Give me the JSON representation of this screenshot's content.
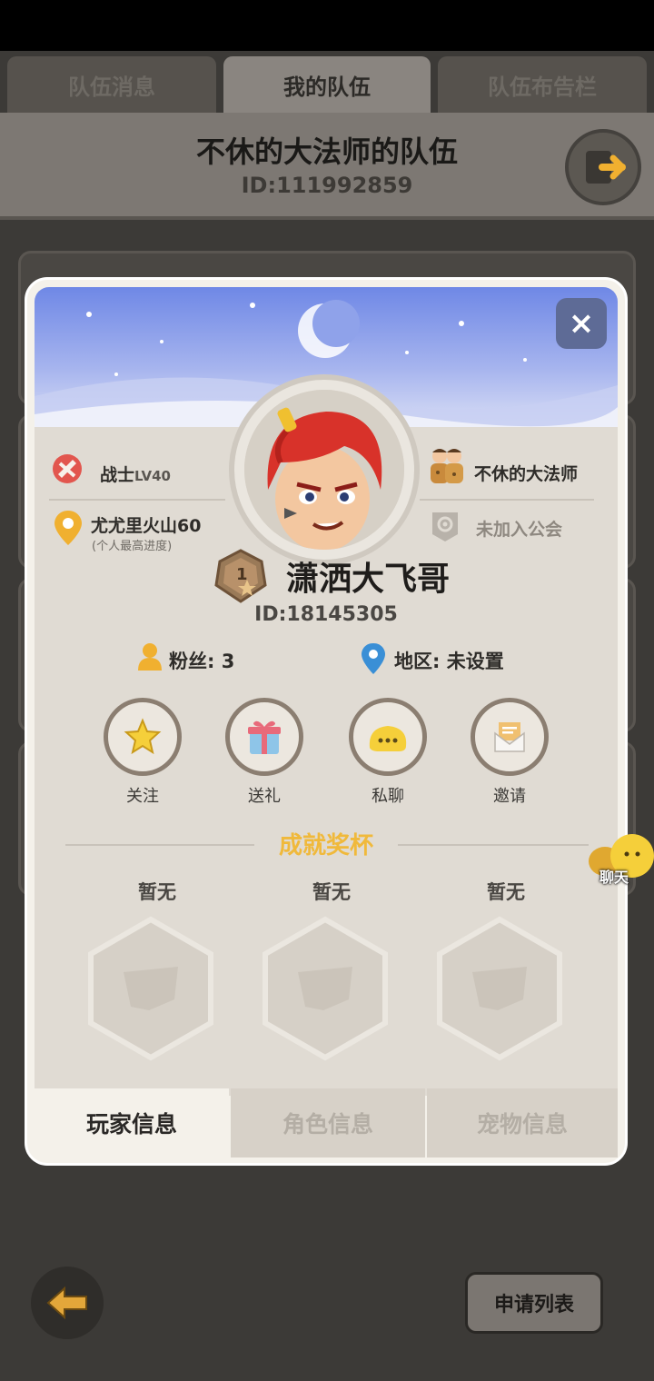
{
  "tabs": [
    {
      "label": "队伍消息",
      "active": false
    },
    {
      "label": "我的队伍",
      "active": true
    },
    {
      "label": "队伍布告栏",
      "active": false
    }
  ],
  "team": {
    "title": "不休的大法师的队伍",
    "id": "ID:111992859"
  },
  "profile": {
    "close_label": "×",
    "class_level": "战士",
    "level_tag": "LV40",
    "progress_main": "尤尤里火山60",
    "progress_note": "(个人最高进度)",
    "team_leader": "不休的大法师",
    "guild": "未加入公会",
    "rank_badge": "1",
    "name": "潇洒大飞哥",
    "id": "ID:18145305",
    "fans": "粉丝: 3",
    "region": "地区: 未设置"
  },
  "actions": [
    {
      "label": "关注",
      "icon": "star-icon"
    },
    {
      "label": "送礼",
      "icon": "gift-icon"
    },
    {
      "label": "私聊",
      "icon": "chat-bubble-icon"
    },
    {
      "label": "邀请",
      "icon": "envelope-icon"
    }
  ],
  "trophies": {
    "title": "成就奖杯",
    "slots": [
      "暂无",
      "暂无",
      "暂无"
    ]
  },
  "bottom_tabs": [
    {
      "label": "玩家信息",
      "active": true
    },
    {
      "label": "角色信息",
      "active": false
    },
    {
      "label": "宠物信息",
      "active": false
    }
  ],
  "chat_float": "聊天",
  "apply_list": "申请列表",
  "colors": {
    "accent_gold": "#f0b93b",
    "modal_bg": "#f4f1ea",
    "close_btn": "#5e6b96",
    "pin_gold": "#f0b030",
    "pin_blue": "#3a8fd6"
  }
}
